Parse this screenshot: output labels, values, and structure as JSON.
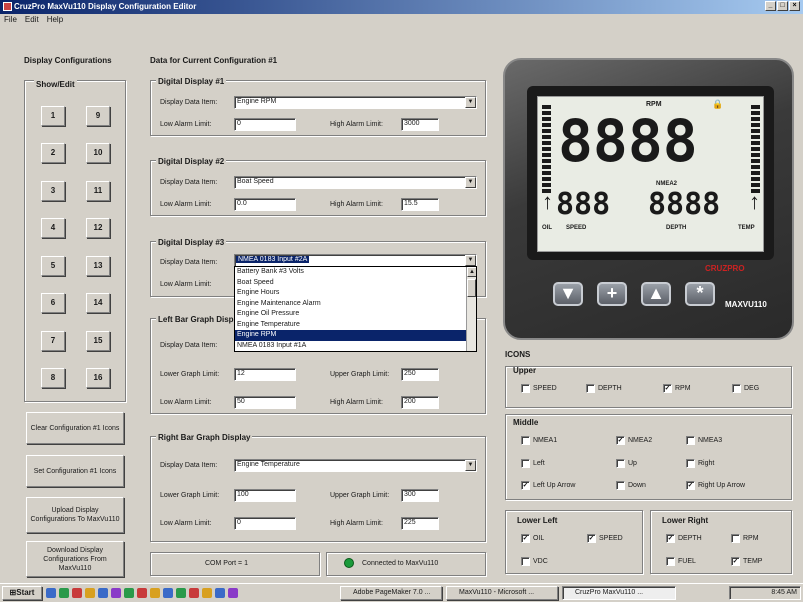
{
  "window": {
    "title": "CruzPro MaxVu110 Display Configuration Editor"
  },
  "menu": [
    "File",
    "Edit",
    "Help"
  ],
  "left": {
    "heading": "Display Configurations",
    "showedit": "Show/Edit",
    "buttons": [
      "1",
      "2",
      "3",
      "4",
      "5",
      "6",
      "7",
      "8",
      "9",
      "10",
      "11",
      "12",
      "13",
      "14",
      "15",
      "16"
    ],
    "clear": "Clear Configuration #1 Icons",
    "set": "Set Configuration #1 Icons",
    "upload": "Upload Display Configurations To MaxVu110",
    "download": "Download Display Configurations From MaxVu110"
  },
  "center": {
    "heading": "Data for Current Configuration #1",
    "labels": {
      "data_item": "Display Data Item:",
      "low_alarm": "Low Alarm Limit:",
      "high_alarm": "High Alarm Limit:",
      "lower_graph": "Lower Graph Limit:",
      "upper_graph": "Upper Graph Limit:"
    },
    "d1": {
      "title": "Digital Display #1",
      "item": "Engine RPM",
      "low": "0",
      "high": "3000"
    },
    "d2": {
      "title": "Digital Display #2",
      "item": "Boat Speed",
      "low": "0.0",
      "high": "15.5"
    },
    "d3": {
      "title": "Digital Display #3",
      "item": "NMEA 0183 Input #2A"
    },
    "dropdown": [
      "Battery Bank #3 Volts",
      "Boat Speed",
      "Engine Hours",
      "Engine Maintenance Alarm",
      "Engine Oil Pressure",
      "Engine Temperature",
      "Engine RPM",
      "NMEA 0183 Input #1A"
    ],
    "left_bar": {
      "title": "Left Bar Graph Display",
      "lower": "12",
      "upper": "250",
      "low": "50",
      "high": "200"
    },
    "right_bar": {
      "title": "Right Bar Graph Display",
      "item": "Engine Temperature",
      "lower": "100",
      "upper": "300",
      "low": "0",
      "high": "225"
    },
    "status_com": "COM Port = 1",
    "status_conn": "Connected to MaxVu110"
  },
  "device": {
    "rpm": "RPM",
    "big": "8888",
    "small_left": "888",
    "small_right": "8888",
    "nmea2": "NMEA2",
    "labels": [
      "OIL",
      "SPEED",
      "DEPTH",
      "TEMP"
    ],
    "brand": "MAXVU110",
    "logo": "CRUZPRO",
    "buttons": [
      "▼",
      "+",
      "▲",
      "*"
    ],
    "colors": {
      "accent": "#cc2222",
      "lcd": "#e9ece4"
    }
  },
  "icons": {
    "heading": "ICONS",
    "upper": {
      "title": "Upper",
      "items": [
        {
          "label": "SPEED",
          "checked": false
        },
        {
          "label": "DEPTH",
          "checked": false
        },
        {
          "label": "RPM",
          "checked": true
        },
        {
          "label": "DEG",
          "checked": false
        }
      ]
    },
    "middle": {
      "title": "Middle",
      "items": [
        {
          "label": "NMEA1",
          "checked": false
        },
        {
          "label": "NMEA2",
          "checked": true
        },
        {
          "label": "NMEA3",
          "checked": false
        },
        {
          "label": "Left",
          "checked": false
        },
        {
          "label": "Up",
          "checked": false
        },
        {
          "label": "Right",
          "checked": false
        },
        {
          "label": "Left Up Arrow",
          "checked": true
        },
        {
          "label": "Down",
          "checked": false
        },
        {
          "label": "Right Up Arrow",
          "checked": true
        }
      ]
    },
    "lower_left": {
      "title": "Lower Left",
      "items": [
        {
          "label": "OIL",
          "checked": true
        },
        {
          "label": "SPEED",
          "checked": true
        },
        {
          "label": "VDC",
          "checked": false
        }
      ]
    },
    "lower_right": {
      "title": "Lower Right",
      "items": [
        {
          "label": "DEPTH",
          "checked": true
        },
        {
          "label": "RPM",
          "checked": false
        },
        {
          "label": "FUEL",
          "checked": false
        },
        {
          "label": "TEMP",
          "checked": true
        }
      ]
    }
  },
  "taskbar": {
    "start": "Start",
    "tasks": [
      "Adobe PageMaker 7.0 ...",
      "MaxVu110 - Microsoft ...",
      "CruzPro MaxVu110 ..."
    ],
    "clock": "8:45 AM"
  }
}
